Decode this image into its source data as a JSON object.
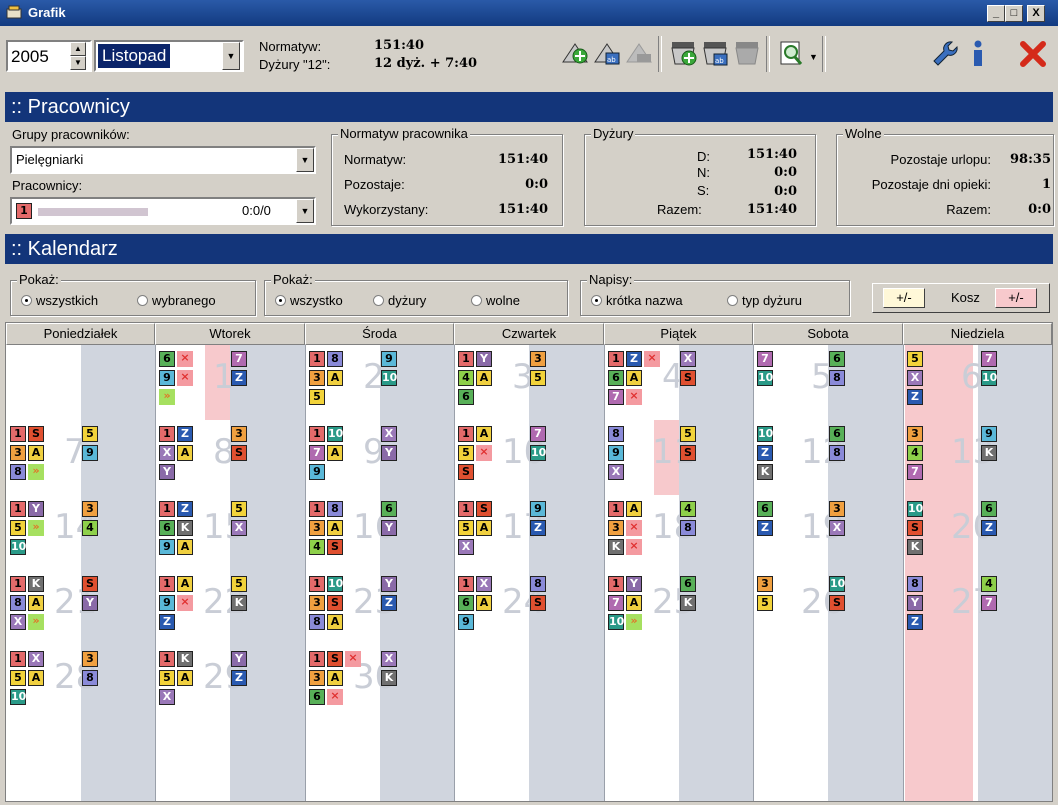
{
  "window": {
    "title": "Grafik",
    "min": "_",
    "max": "□",
    "close": "X"
  },
  "toolbar": {
    "year": "2005",
    "month": "Listopad",
    "norm_label": "Normatyw:",
    "norm_value": "151:40",
    "duty_label": "Dyżury \"12\":",
    "duty_value": "12 dyż. + 7:40"
  },
  "employees": {
    "title": ":: Pracownicy",
    "groups_label": "Grupy pracowników:",
    "group_value": "Pielęgniarki",
    "employees_label": "Pracownicy:",
    "employee_badge": "1",
    "employee_value": "0:0/0",
    "norm_box": {
      "title": "Normatyw pracownika",
      "rows": [
        {
          "label": "Normatyw:",
          "value": "151:40"
        },
        {
          "label": "Pozostaje:",
          "value": "0:0"
        },
        {
          "label": "Wykorzystany:",
          "value": "151:40"
        }
      ]
    },
    "duty_box": {
      "title": "Dyżury",
      "d_label": "D:",
      "d_value": "151:40",
      "n_label": "N:",
      "n_value": "0:0",
      "s_label": "S:",
      "s_value": "0:0",
      "total_label": "Razem:",
      "total_value": "151:40"
    },
    "free_box": {
      "title": "Wolne",
      "rows": [
        {
          "label": "Pozostaje urlopu:",
          "value": "98:35"
        },
        {
          "label": "Pozostaje dni opieki:",
          "value": "1"
        },
        {
          "label": "Razem:",
          "value": "0:0"
        }
      ]
    }
  },
  "calendar": {
    "title": ":: Kalendarz",
    "show1": {
      "label": "Pokaż:",
      "opt1": "wszystkich",
      "opt2": "wybranego"
    },
    "show2": {
      "label": "Pokaż:",
      "opt1": "wszystko",
      "opt2": "dyżury",
      "opt3": "wolne"
    },
    "captions": {
      "label": "Napisy:",
      "opt1": "krótka nazwa",
      "opt2": "typ dyżuru"
    },
    "plusminus": "+/-",
    "bin_label": "Kosz",
    "days": [
      "Poniedziałek",
      "Wtorek",
      "Środa",
      "Czwartek",
      "Piątek",
      "Sobota",
      "Niedziela"
    ],
    "colors": {
      "1": "#e46a6a",
      "2": "#3a6fbf",
      "3": "#f0a040",
      "4": "#8ed04a",
      "5": "#f2d33a",
      "6": "#58b058",
      "7": "#b06ab0",
      "8": "#8a8ad8",
      "9": "#5ab8d8",
      "10": "#2a9a88",
      "S": "#e05030",
      "A": "#f0d040",
      "X": "#9a78b8",
      "Z": "#2a5ab0",
      "Y": "#8a6aa8",
      "K": "#707070",
      "»": "#a6e060",
      "×": "#f49aa0"
    },
    "weeks": [
      {
        "days": [
          null,
          {
            "n": "1",
            "L": [
              "6",
              "9",
              "»"
            ],
            "M": [
              "×",
              "×"
            ],
            "R": [
              "7",
              "Z"
            ],
            "pink": true
          },
          {
            "n": "2",
            "L": [
              "1",
              "3",
              "5"
            ],
            "M": [
              "8",
              "A"
            ],
            "R": [
              "9",
              "10"
            ]
          },
          {
            "n": "3",
            "L": [
              "1",
              "4",
              "6"
            ],
            "M": [
              "Y",
              "A"
            ],
            "R": [
              "3",
              "5"
            ]
          },
          {
            "n": "4",
            "L": [
              "1",
              "6",
              "7"
            ],
            "M": [
              "Z",
              "A",
              "×"
            ],
            "R": [
              "X",
              "S"
            ],
            "extra": "×"
          },
          {
            "n": "5",
            "L": [
              "7",
              "10"
            ],
            "M": [],
            "R": [
              "6",
              "8"
            ]
          },
          {
            "n": "6",
            "L": [
              "5",
              "X",
              "Z"
            ],
            "M": [],
            "R": [
              "7",
              "10"
            ],
            "pink": true
          }
        ]
      },
      {
        "days": [
          {
            "n": "7",
            "L": [
              "1",
              "3",
              "8"
            ],
            "M": [
              "S",
              "A",
              "»"
            ],
            "R": [
              "5",
              "9"
            ]
          },
          {
            "n": "8",
            "L": [
              "1",
              "X",
              "Y"
            ],
            "M": [
              "Z",
              "A"
            ],
            "R": [
              "3",
              "S"
            ]
          },
          {
            "n": "9",
            "L": [
              "1",
              "7",
              "9"
            ],
            "M": [
              "10",
              "A"
            ],
            "R": [
              "X",
              "Y"
            ]
          },
          {
            "n": "10",
            "L": [
              "1",
              "5",
              "S"
            ],
            "M": [
              "A",
              "×"
            ],
            "R": [
              "7",
              "10"
            ]
          },
          {
            "n": "11",
            "L": [
              "8",
              "9",
              "X"
            ],
            "M": [],
            "R": [
              "5",
              "S"
            ],
            "pink": true
          },
          {
            "n": "12",
            "L": [
              "10",
              "Z",
              "K"
            ],
            "M": [],
            "R": [
              "6",
              "8"
            ]
          },
          {
            "n": "13",
            "L": [
              "3",
              "4",
              "7"
            ],
            "M": [],
            "R": [
              "9",
              "K"
            ],
            "pink": true
          }
        ]
      },
      {
        "days": [
          {
            "n": "14",
            "L": [
              "1",
              "5",
              "10"
            ],
            "M": [
              "Y",
              "»"
            ],
            "R": [
              "3",
              "4"
            ]
          },
          {
            "n": "15",
            "L": [
              "1",
              "6",
              "9"
            ],
            "M": [
              "Z",
              "K",
              "A"
            ],
            "R": [
              "5",
              "X"
            ]
          },
          {
            "n": "16",
            "L": [
              "1",
              "3",
              "4"
            ],
            "M": [
              "8",
              "A",
              "S"
            ],
            "R": [
              "6",
              "Y"
            ]
          },
          {
            "n": "17",
            "L": [
              "1",
              "5",
              "X"
            ],
            "M": [
              "S",
              "A"
            ],
            "R": [
              "9",
              "Z"
            ]
          },
          {
            "n": "18",
            "L": [
              "1",
              "3",
              "K"
            ],
            "M": [
              "A",
              "×",
              "×"
            ],
            "R": [
              "4",
              "8"
            ]
          },
          {
            "n": "19",
            "L": [
              "6",
              "Z"
            ],
            "M": [],
            "R": [
              "3",
              "X"
            ]
          },
          {
            "n": "20",
            "L": [
              "10",
              "S",
              "K"
            ],
            "M": [],
            "R": [
              "6",
              "Z"
            ],
            "pink": true
          }
        ]
      },
      {
        "days": [
          {
            "n": "21",
            "L": [
              "1",
              "8",
              "X"
            ],
            "M": [
              "K",
              "A",
              "»"
            ],
            "R": [
              "S",
              "Y"
            ]
          },
          {
            "n": "22",
            "L": [
              "1",
              "9",
              "Z"
            ],
            "M": [
              "A",
              "×"
            ],
            "R": [
              "5",
              "K"
            ]
          },
          {
            "n": "23",
            "L": [
              "1",
              "3",
              "8"
            ],
            "M": [
              "10",
              "S",
              "A"
            ],
            "R": [
              "Y",
              "Z"
            ]
          },
          {
            "n": "24",
            "L": [
              "1",
              "6",
              "9"
            ],
            "M": [
              "X",
              "A"
            ],
            "R": [
              "8",
              "S"
            ]
          },
          {
            "n": "25",
            "L": [
              "1",
              "7",
              "10"
            ],
            "M": [
              "Y",
              "A",
              "»"
            ],
            "R": [
              "6",
              "K"
            ]
          },
          {
            "n": "26",
            "L": [
              "3",
              "5"
            ],
            "M": [],
            "R": [
              "10",
              "S"
            ]
          },
          {
            "n": "27",
            "L": [
              "8",
              "Y",
              "Z"
            ],
            "M": [],
            "R": [
              "4",
              "7"
            ],
            "pink": true
          }
        ]
      },
      {
        "days": [
          {
            "n": "28",
            "L": [
              "1",
              "5",
              "10"
            ],
            "M": [
              "X",
              "A"
            ],
            "R": [
              "3",
              "8"
            ]
          },
          {
            "n": "29",
            "L": [
              "1",
              "5",
              "X"
            ],
            "M": [
              "K",
              "A"
            ],
            "R": [
              "Y",
              "Z"
            ]
          },
          {
            "n": "30",
            "L": [
              "1",
              "3",
              "6"
            ],
            "M": [
              "S",
              "A",
              "×"
            ],
            "R": [
              "X",
              "K"
            ],
            "extra": "×"
          },
          null,
          null,
          null,
          {
            "pinkonly": true
          }
        ]
      }
    ]
  }
}
